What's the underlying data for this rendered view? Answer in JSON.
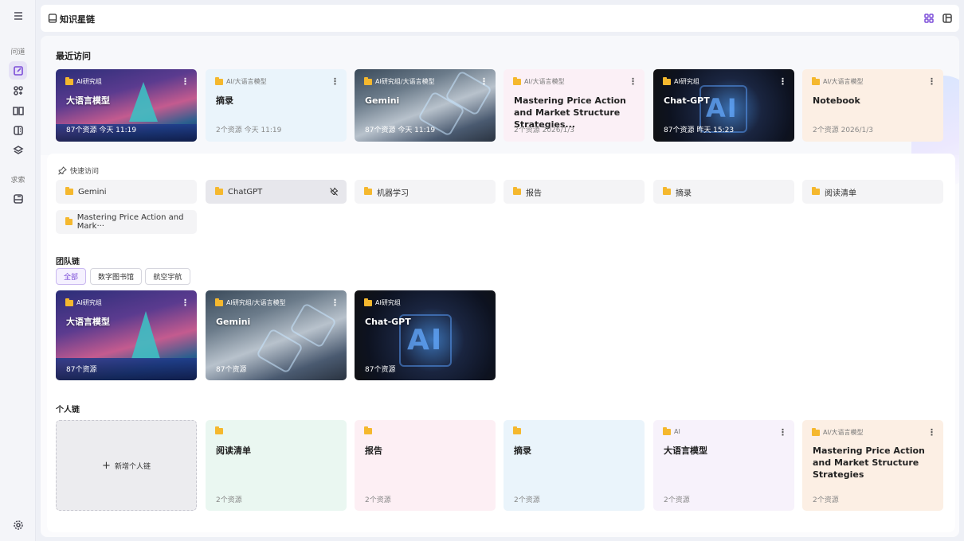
{
  "app": {
    "title": "知识星链"
  },
  "rail": {
    "items": [
      {
        "kind": "text",
        "label": "问道"
      },
      {
        "kind": "icon",
        "icon": "edit-icon",
        "active": true
      },
      {
        "kind": "icon",
        "icon": "apps-icon"
      },
      {
        "kind": "icon",
        "icon": "book-open-icon"
      },
      {
        "kind": "icon",
        "icon": "document-icon"
      },
      {
        "kind": "icon",
        "icon": "layers-icon"
      },
      {
        "kind": "text",
        "label": "求索"
      },
      {
        "kind": "icon",
        "icon": "database-icon"
      }
    ],
    "settings_icon": "gear-icon"
  },
  "header": {
    "grid_view_icon": "grid-icon",
    "layout_icon": "panel-icon"
  },
  "recent": {
    "title": "最近访问",
    "cards": [
      {
        "crumb": "AI研究组",
        "title": "大语言模型",
        "meta": "87个资源  今天 11:19",
        "style": "img-llm"
      },
      {
        "crumb": "AI/大语言模型",
        "title": "摘录",
        "meta": "2个资源  今天 11:19",
        "style": "light",
        "bg": "#eaf4fb"
      },
      {
        "crumb": "AI研究组/大语言模型",
        "title": "Gemini",
        "meta": "87个资源  今天 11:19",
        "style": "img-gem"
      },
      {
        "crumb": "AI/大语言模型",
        "title": "Mastering Price Action and Market Structure Strategies...",
        "meta": "2个资源  2026/1/3",
        "style": "light",
        "bg": "#fbf0f6"
      },
      {
        "crumb": "AI研究组",
        "title": "Chat-GPT",
        "meta": "87个资源  昨天 15:23",
        "style": "img-gpt"
      },
      {
        "crumb": "AI/大语言模型",
        "title": "Notebook",
        "meta": "2个资源  2026/1/3",
        "style": "light",
        "bg": "#fcefe4"
      }
    ]
  },
  "quick": {
    "title": "快速访问",
    "items": [
      {
        "label": "Gemini"
      },
      {
        "label": "ChatGPT",
        "selected": true
      },
      {
        "label": "机器学习"
      },
      {
        "label": "报告"
      },
      {
        "label": "摘录"
      },
      {
        "label": "阅读清单"
      },
      {
        "label": "Mastering Price Action and Mark···"
      }
    ]
  },
  "team": {
    "title": "团队链",
    "tabs": [
      "全部",
      "数字图书馆",
      "航空宇航"
    ],
    "cards": [
      {
        "crumb": "AI研究组",
        "title": "大语言模型",
        "meta": "87个资源",
        "style": "img-llm"
      },
      {
        "crumb": "AI研究组/大语言模型",
        "title": "Gemini",
        "meta": "87个资源",
        "style": "img-gem"
      },
      {
        "crumb": "AI研究组",
        "title": "Chat-GPT",
        "meta": "87个资源",
        "style": "img-gpt"
      }
    ]
  },
  "personal": {
    "title": "个人链",
    "add_label": "新增个人链",
    "cards": [
      {
        "crumb": "",
        "title": "阅读清单",
        "meta": "2个资源",
        "bg": "#eaf7f1",
        "more": false
      },
      {
        "crumb": "",
        "title": "报告",
        "meta": "2个资源",
        "bg": "#fdeff4",
        "more": false
      },
      {
        "crumb": "",
        "title": "摘录",
        "meta": "2个资源",
        "bg": "#eaf4fb",
        "more": false
      },
      {
        "crumb": "AI",
        "title": "大语言模型",
        "meta": "2个资源",
        "bg": "#f7f2fb",
        "more": true
      },
      {
        "crumb": "AI/大语言模型",
        "title": "Mastering Price Action and Market Structure Strategies",
        "meta": "2个资源",
        "bg": "#fcefe4",
        "more": true
      }
    ]
  },
  "colors": {
    "accent": "#7c4dd8",
    "folder": "#f5b82e"
  }
}
